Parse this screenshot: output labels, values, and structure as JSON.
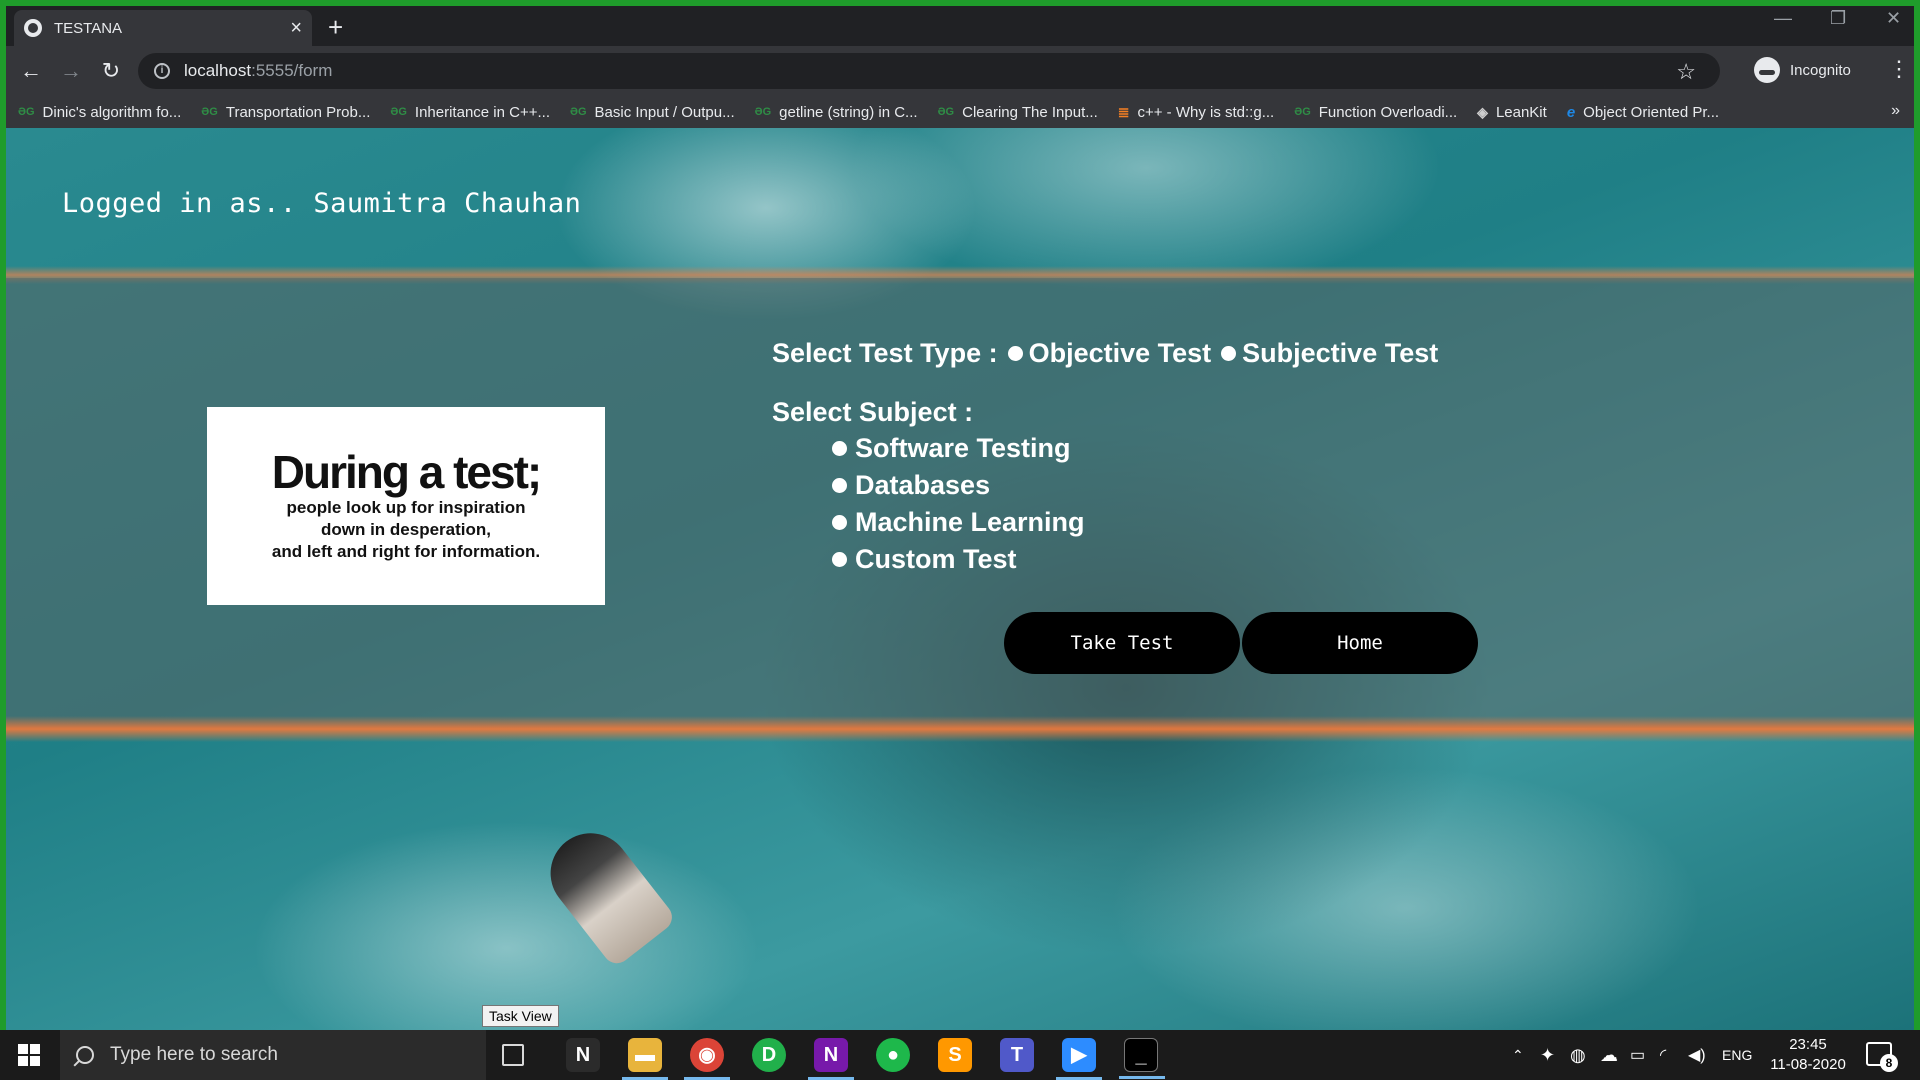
{
  "browser": {
    "tab_title": "TESTANA",
    "url_host": "localhost",
    "url_path": ":5555/form",
    "profile_label": "Incognito",
    "bookmarks": [
      {
        "label": "Dinic's algorithm fo...",
        "icon": "gfg-icon"
      },
      {
        "label": "Transportation Prob...",
        "icon": "gfg-icon"
      },
      {
        "label": "Inheritance in C++...",
        "icon": "gfg-icon"
      },
      {
        "label": "Basic Input / Outpu...",
        "icon": "gfg-icon"
      },
      {
        "label": "getline (string) in C...",
        "icon": "gfg-icon"
      },
      {
        "label": "Clearing The Input...",
        "icon": "gfg-icon"
      },
      {
        "label": "c++ - Why is std::g...",
        "icon": "stackoverflow-icon"
      },
      {
        "label": "Function Overloadi...",
        "icon": "gfg-icon"
      },
      {
        "label": "LeanKit",
        "icon": "leankit-icon"
      },
      {
        "label": "Object Oriented Pr...",
        "icon": "ie-icon"
      }
    ]
  },
  "page": {
    "logged_in_text": "Logged in as.. Saumitra Chauhan",
    "quote": {
      "heading": "During a test;",
      "line1": "people look up for inspiration",
      "line2": "down in desperation,",
      "line3": "and left and right for information."
    },
    "form": {
      "test_type_label": "Select Test Type :",
      "test_types": [
        "Objective Test",
        "Subjective Test"
      ],
      "subject_label": "Select Subject :",
      "subjects": [
        "Software Testing",
        "Databases",
        "Machine Learning",
        "Custom Test"
      ],
      "take_test_label": "Take Test",
      "home_label": "Home"
    }
  },
  "os": {
    "tooltip": "Task View",
    "search_placeholder": "Type here to search",
    "language": "ENG",
    "time": "23:45",
    "date": "11-08-2020",
    "notification_count": "8",
    "accent_color": "#76b9ed"
  }
}
